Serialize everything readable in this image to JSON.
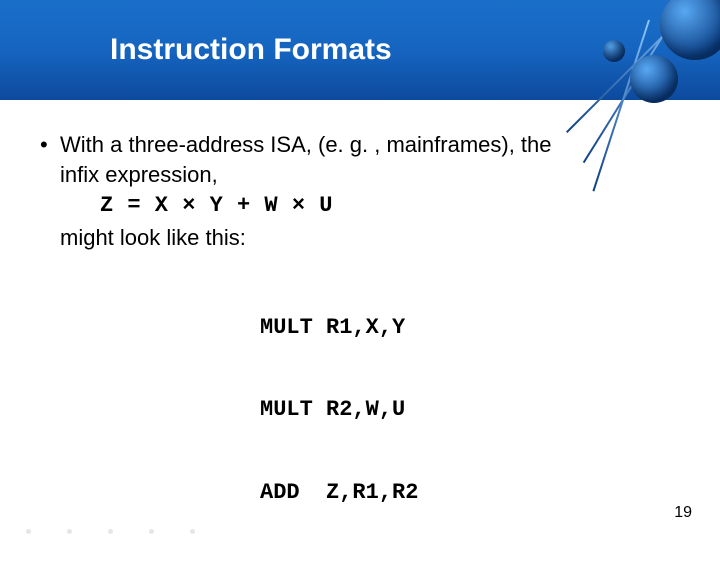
{
  "header": {
    "title": "Instruction Formats"
  },
  "bullet": {
    "line1": "With a three-address ISA, (e. g. , mainframes), the",
    "line2": "infix expression,",
    "expression": "Z = X × Y + W × U",
    "line3": "might look like this:"
  },
  "code": {
    "l1": "MULT R1,X,Y",
    "l2": "MULT R2,W,U",
    "l3": "ADD  Z,R1,R2"
  },
  "page_number": "19"
}
